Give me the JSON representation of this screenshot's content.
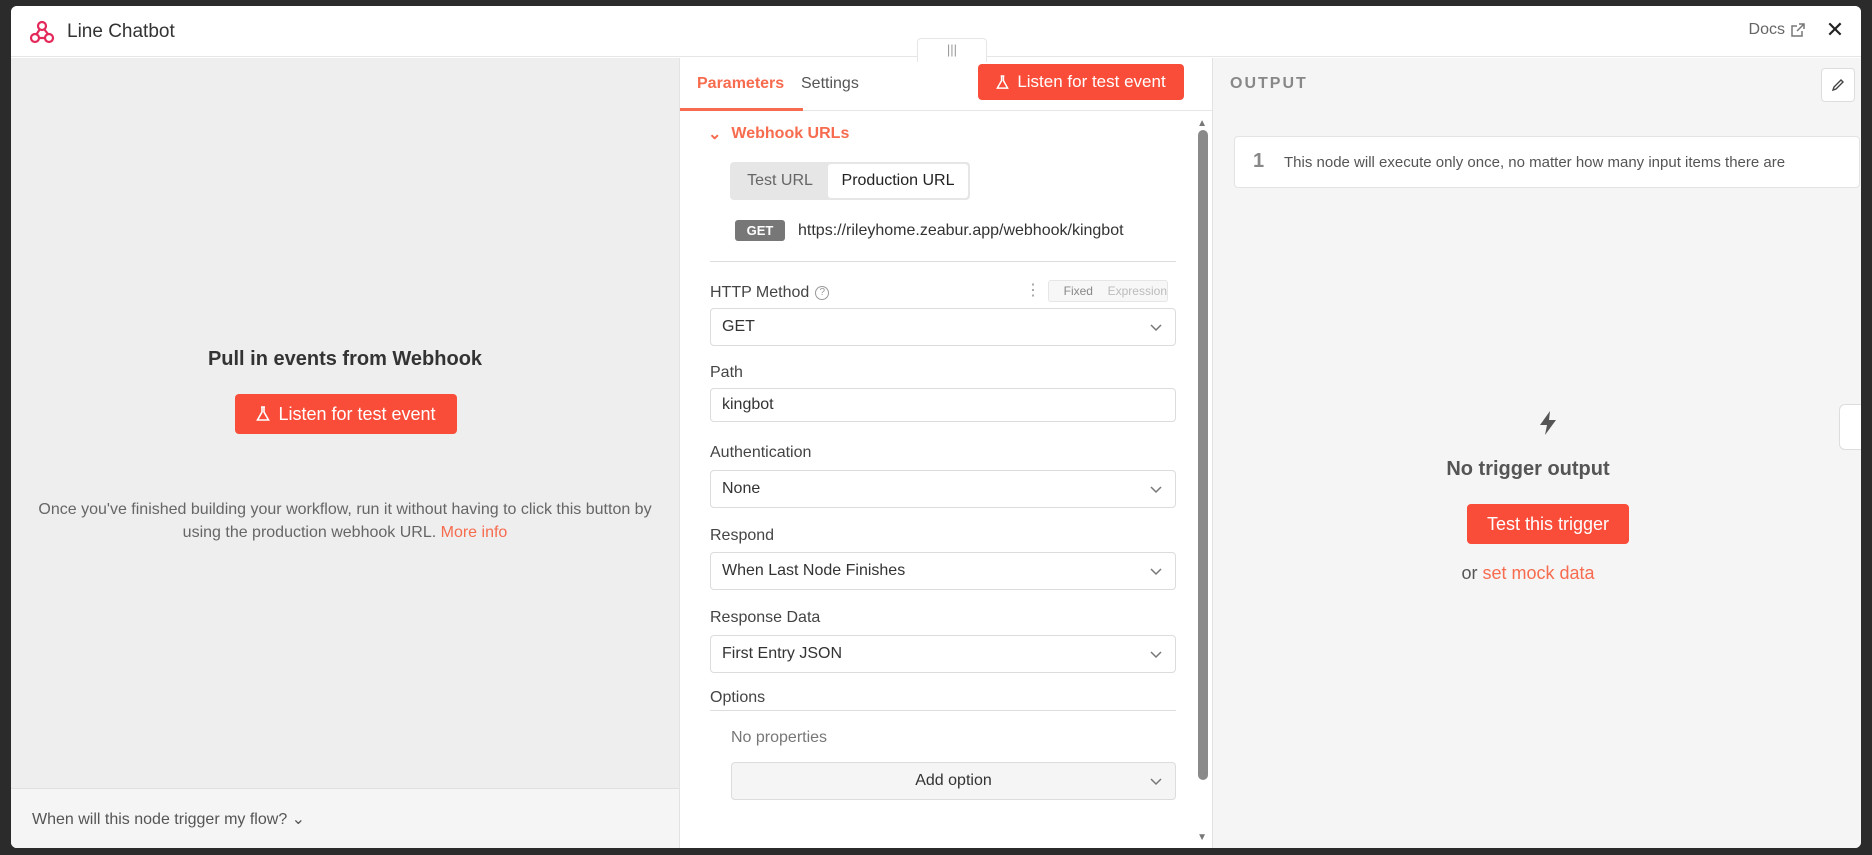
{
  "header": {
    "title": "Line Chatbot",
    "docs_label": "Docs"
  },
  "left_panel": {
    "heading": "Pull in events from Webhook",
    "listen_button": "Listen for test event",
    "hint": "Once you've finished building your workflow, run it without having to click this button by using the production webhook URL.",
    "more_info": "More info",
    "footer_question": "When will this node trigger my flow?"
  },
  "params_panel": {
    "tabs": [
      "Parameters",
      "Settings"
    ],
    "listen_button": "Listen for test event",
    "webhook_section": "Webhook URLs",
    "url_toggle": [
      "Test URL",
      "Production URL"
    ],
    "method_badge": "GET",
    "webhook_url": "https://rileyhome.zeabur.app/webhook/kingbot",
    "http_method": {
      "label": "HTTP Method",
      "value": "GET",
      "mode_fixed": "Fixed",
      "mode_expression": "Expression"
    },
    "path": {
      "label": "Path",
      "value": "kingbot"
    },
    "authentication": {
      "label": "Authentication",
      "value": "None"
    },
    "respond": {
      "label": "Respond",
      "value": "When Last Node Finishes"
    },
    "response_data": {
      "label": "Response Data",
      "value": "First Entry JSON"
    },
    "options": {
      "label": "Options",
      "empty": "No properties",
      "add_button": "Add option"
    }
  },
  "output_panel": {
    "title": "OUTPUT",
    "notice_number": "1",
    "notice_text": "This node will execute only once, no matter how many input items there are",
    "empty_title": "No trigger output",
    "test_button": "Test this trigger",
    "or_text": "or",
    "mock_link": "set mock data"
  },
  "colors": {
    "accent": "#f94d3a",
    "link": "#f76b4e"
  }
}
